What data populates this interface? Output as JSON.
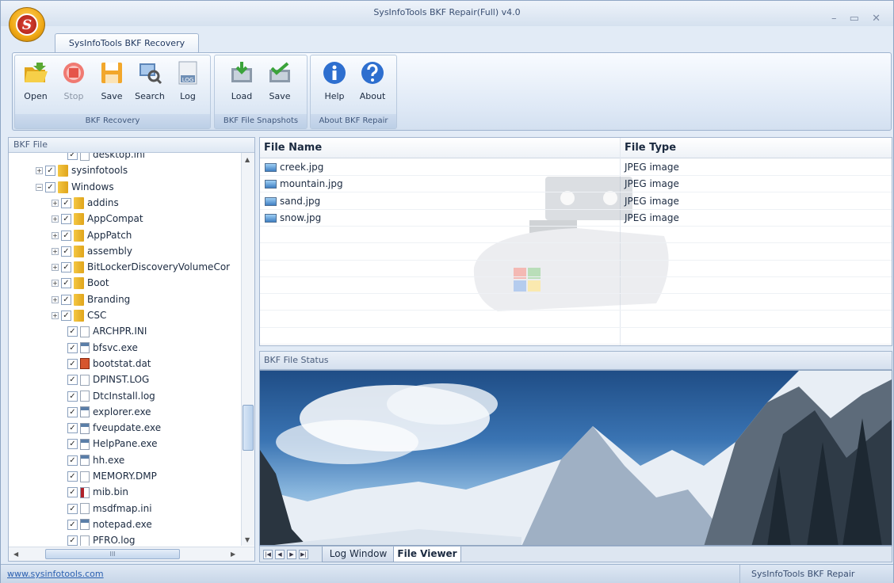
{
  "window": {
    "title": "SysInfoTools BKF Repair(Full) v4.0",
    "controls": "– ▭ ✕",
    "orb_letter": "S"
  },
  "tab": {
    "label": "SysInfoTools BKF Recovery"
  },
  "ribbon": {
    "groups": [
      {
        "label": "BKF Recovery",
        "buttons": [
          {
            "label": "Open",
            "icon": "open-folder-icon"
          },
          {
            "label": "Stop",
            "icon": "stop-icon"
          },
          {
            "label": "Save",
            "icon": "save-icon"
          },
          {
            "label": "Search",
            "icon": "search-icon"
          },
          {
            "label": "Log",
            "icon": "log-icon"
          }
        ]
      },
      {
        "label": "BKF File Snapshots",
        "buttons": [
          {
            "label": "Load",
            "icon": "load-icon"
          },
          {
            "label": "Save",
            "icon": "save-snapshot-icon"
          }
        ]
      },
      {
        "label": "About BKF Repair",
        "buttons": [
          {
            "label": "Help",
            "icon": "info-icon"
          },
          {
            "label": "About",
            "icon": "question-icon"
          }
        ]
      }
    ],
    "log_badge": "LOG"
  },
  "left_pane": {
    "title": "BKF File",
    "hscroll_grip": "III",
    "tree": [
      {
        "label": "desktop.ini",
        "type": "ini",
        "expander": ""
      },
      {
        "label": "sysinfotools",
        "type": "folder",
        "expander": "+"
      },
      {
        "label": "Windows",
        "type": "folder",
        "expander": "−"
      },
      {
        "label": "addins",
        "type": "folder",
        "expander": "+"
      },
      {
        "label": "AppCompat",
        "type": "folder",
        "expander": "+"
      },
      {
        "label": "AppPatch",
        "type": "folder",
        "expander": "+"
      },
      {
        "label": "assembly",
        "type": "folder",
        "expander": "+"
      },
      {
        "label": "BitLockerDiscoveryVolumeCor",
        "type": "folder",
        "expander": "+"
      },
      {
        "label": "Boot",
        "type": "folder",
        "expander": "+"
      },
      {
        "label": "Branding",
        "type": "folder",
        "expander": "+"
      },
      {
        "label": "CSC",
        "type": "folder",
        "expander": "+"
      },
      {
        "label": "ARCHPR.INI",
        "type": "ini",
        "expander": ""
      },
      {
        "label": "bfsvc.exe",
        "type": "exe",
        "expander": ""
      },
      {
        "label": "bootstat.dat",
        "type": "dat",
        "expander": ""
      },
      {
        "label": "DPINST.LOG",
        "type": "blank",
        "expander": ""
      },
      {
        "label": "DtcInstall.log",
        "type": "blank",
        "expander": ""
      },
      {
        "label": "explorer.exe",
        "type": "exe",
        "expander": ""
      },
      {
        "label": "fveupdate.exe",
        "type": "exe",
        "expander": ""
      },
      {
        "label": "HelpPane.exe",
        "type": "exe",
        "expander": ""
      },
      {
        "label": "hh.exe",
        "type": "exe",
        "expander": ""
      },
      {
        "label": "MEMORY.DMP",
        "type": "blank",
        "expander": ""
      },
      {
        "label": "mib.bin",
        "type": "bin",
        "expander": ""
      },
      {
        "label": "msdfmap.ini",
        "type": "ini",
        "expander": ""
      },
      {
        "label": "notepad.exe",
        "type": "exe",
        "expander": ""
      },
      {
        "label": "PFRO.log",
        "type": "blank",
        "expander": ""
      }
    ]
  },
  "file_list": {
    "headers": {
      "name": "File Name",
      "type": "File Type"
    },
    "rows": [
      {
        "name": "creek.jpg",
        "type": "JPEG image"
      },
      {
        "name": "mountain.jpg",
        "type": "JPEG image"
      },
      {
        "name": "sand.jpg",
        "type": "JPEG image"
      },
      {
        "name": "snow.jpg",
        "type": "JPEG image"
      }
    ]
  },
  "status_section": {
    "title": "BKF File Status"
  },
  "bottom_tabs": {
    "nav": [
      "|◀",
      "◀",
      "▶",
      "▶|"
    ],
    "tabs": [
      {
        "label": "Log Window",
        "active": false
      },
      {
        "label": "File Viewer",
        "active": true
      }
    ]
  },
  "statusbar": {
    "link": "www.sysinfotools.com",
    "right": "SysInfoTools BKF Repair"
  },
  "colors": {
    "accent": "#4a7ac7",
    "folder": "#f0b429",
    "link": "#2a5fb0"
  }
}
